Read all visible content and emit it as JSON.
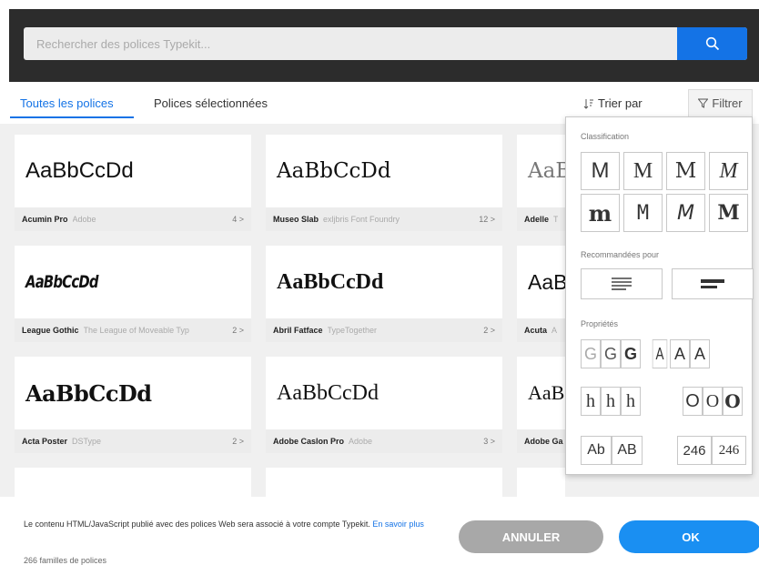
{
  "search": {
    "placeholder": "Rechercher des polices Typekit..."
  },
  "tabs": [
    {
      "label": "Toutes les polices",
      "active": true
    },
    {
      "label": "Polices sélectionnées",
      "active": false
    }
  ],
  "toolbar": {
    "sort_label": "Trier par",
    "filter_label": "Filtrer"
  },
  "cards": [
    {
      "sample": "AaBbCcDd",
      "name": "Acumin Pro",
      "foundry": "Adobe",
      "count": "4 >"
    },
    {
      "sample": "AaBbCcDd",
      "name": "Museo Slab",
      "foundry": "exljbris Font Foundry",
      "count": "12 >"
    },
    {
      "sample": "AaB",
      "name": "Adelle",
      "foundry": "T",
      "count": ""
    },
    {
      "sample": "AaBbCcDd",
      "name": "League Gothic",
      "foundry": "The League of Moveable Typ",
      "count": "2 >"
    },
    {
      "sample": "AaBbCcDd",
      "name": "Abril Fatface",
      "foundry": "TypeTogether",
      "count": "2 >"
    },
    {
      "sample": "AaB",
      "name": "Acuta",
      "foundry": "A",
      "count": ""
    },
    {
      "sample": "AaBbCcDd",
      "name": "Acta Poster",
      "foundry": "DSType",
      "count": "2 >"
    },
    {
      "sample": "AaBbCcDd",
      "name": "Adobe Caslon Pro",
      "foundry": "Adobe",
      "count": "3 >"
    },
    {
      "sample": "AaB",
      "name": "Adobe Ga",
      "foundry": "",
      "count": ""
    }
  ],
  "filter_panel": {
    "classification_label": "Classification",
    "classification": [
      "M",
      "M",
      "M",
      "M",
      "m",
      "M",
      "M",
      "M"
    ],
    "recommended_label": "Recommandées pour",
    "properties_label": "Propriétés",
    "weights": [
      "G",
      "G",
      "G"
    ],
    "widths": [
      "A",
      "A",
      "A"
    ],
    "xheights": [
      "h",
      "h",
      "h"
    ],
    "contrast": [
      "O",
      "O",
      "O"
    ],
    "case": [
      "Ab",
      "AB"
    ],
    "numerals": [
      "246",
      "246"
    ]
  },
  "footer": {
    "notice": "Le contenu HTML/JavaScript publié avec des polices Web sera associé à votre compte Typekit.",
    "learn_more": "En savoir plus",
    "family_count": "266 familles de polices",
    "cancel_label": "ANNULER",
    "ok_label": "OK"
  },
  "colors": {
    "accent": "#1473e6",
    "ok": "#1a8ff2",
    "cancel": "#a8a8a8",
    "header": "#2c2c2c"
  }
}
